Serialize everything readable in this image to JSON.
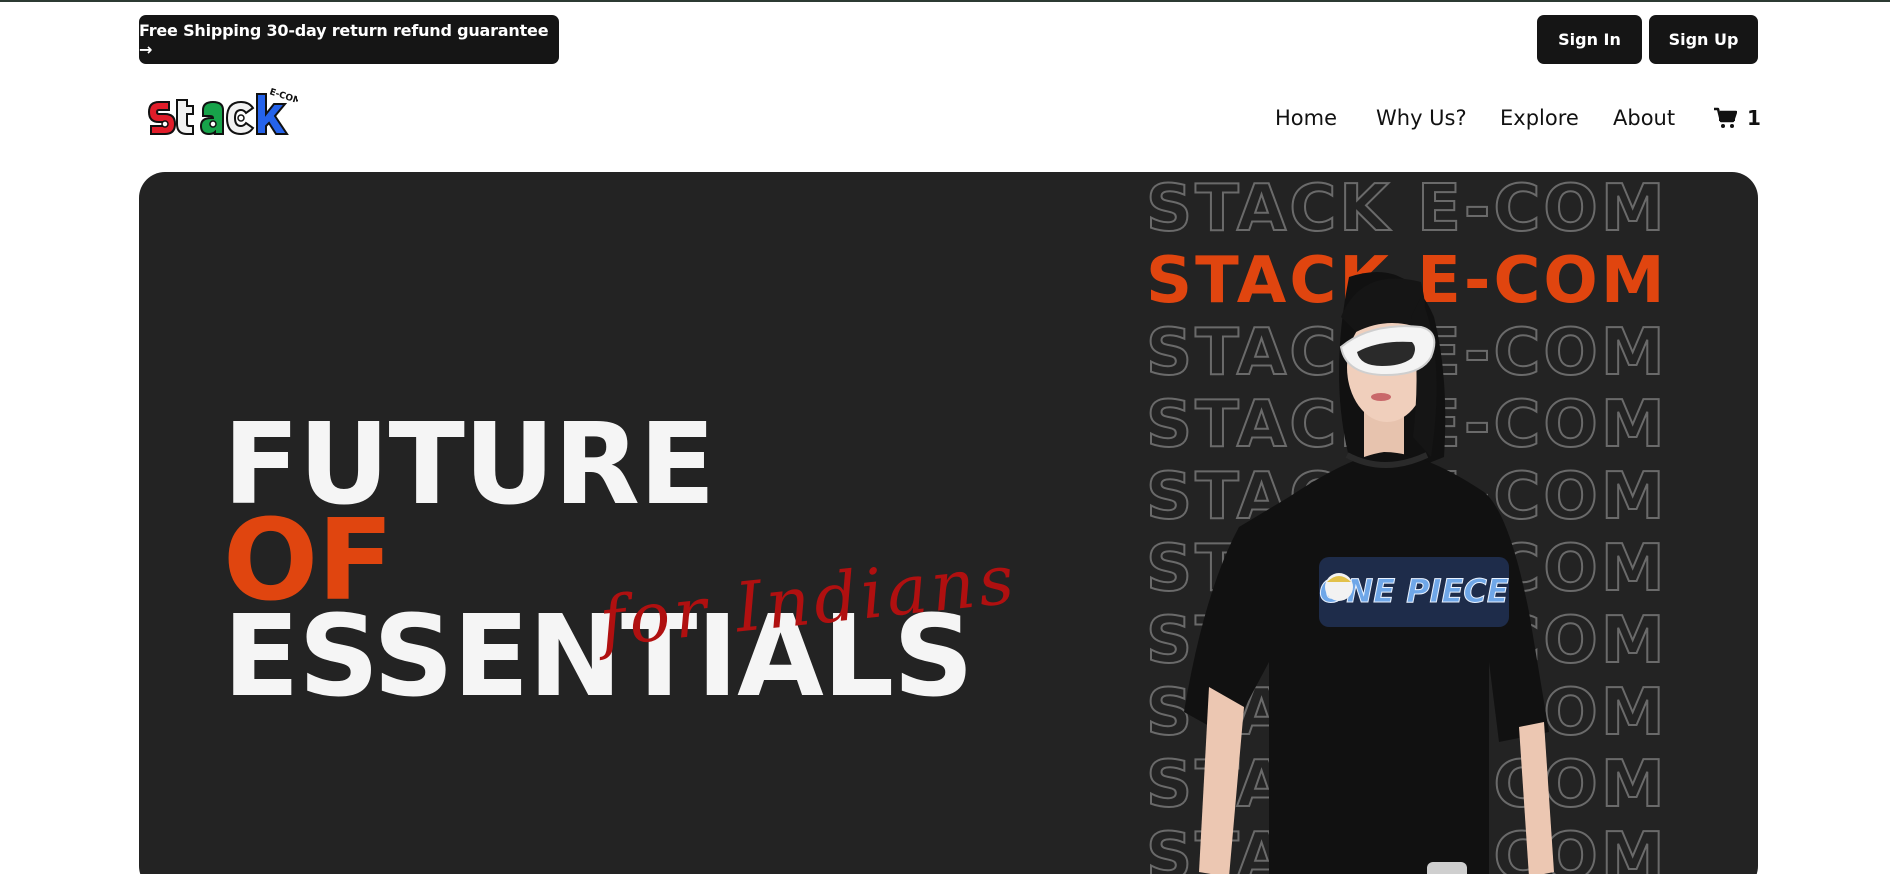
{
  "topbar": {
    "promo_label": "Free Shipping 30-day return refund guarantee →",
    "signin_label": "Sign In",
    "signup_label": "Sign Up"
  },
  "logo": {
    "wordmark": "stack",
    "tag": "E-COM"
  },
  "nav": {
    "items": [
      {
        "label": "Home"
      },
      {
        "label": "Why Us?"
      },
      {
        "label": "Explore"
      },
      {
        "label": "About"
      }
    ],
    "cart_icon": "cart-icon",
    "cart_count": "1"
  },
  "hero": {
    "line1": "FUTURE",
    "line2": "OF",
    "line3": "ESSENTIALS",
    "script": "for Indians",
    "stack_text": "STACK E-COM",
    "shirt_print": "ONE PIECE"
  },
  "colors": {
    "dark": "#151515",
    "hero_bg": "#232323",
    "accent_orange": "#e0450f",
    "script_red": "#b01010"
  }
}
